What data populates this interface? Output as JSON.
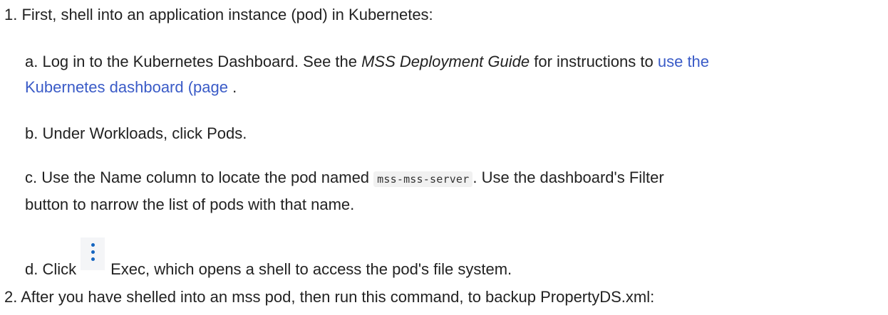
{
  "steps": {
    "one": {
      "head": "1. First, shell into an application instance (pod) in Kubernetes:",
      "a": {
        "text1": "a. Log in to the Kubernetes Dashboard. See the ",
        "guide": "MSS Deployment Guide",
        "text2": " for instructions to ",
        "link_line1": "use the",
        "link_line2": "Kubernetes dashboard (page",
        "text3": " ."
      },
      "b": {
        "text": "b. Under Workloads, click Pods."
      },
      "c": {
        "text1": "c. Use the Name column to locate the pod named ",
        "code": "mss-mss-server",
        "text2": ". Use the dashboard's Filter",
        "text3": "button to narrow the list of pods with that name."
      },
      "d": {
        "text1": "d. Click",
        "icon": "kebab-menu-icon",
        "text2": "Exec, which opens a shell to access the pod's file system."
      }
    },
    "two": {
      "head": "2. After you have shelled into an mss pod, then run this command, to backup PropertyDS.xml:"
    }
  },
  "colors": {
    "link": "#3a5bc7",
    "icon": "#1565c0",
    "text": "#222222"
  }
}
